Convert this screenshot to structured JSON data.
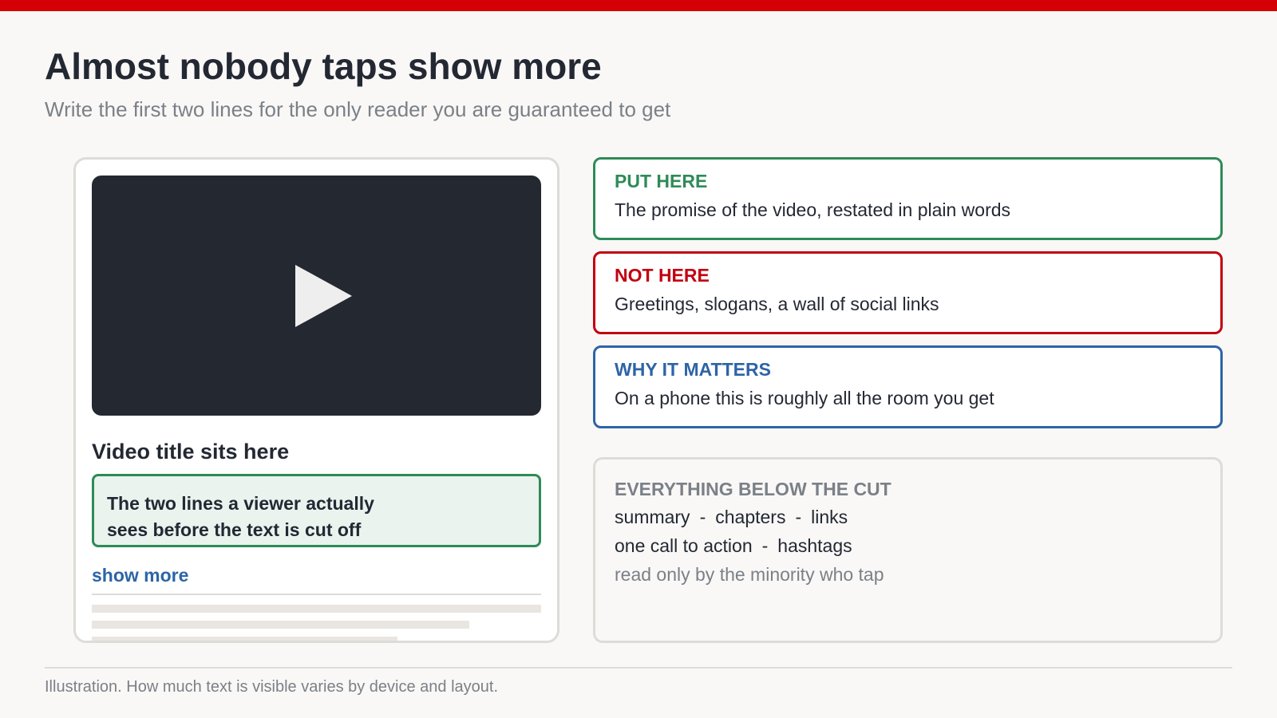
{
  "header": {
    "title": "Almost nobody taps show more",
    "subtitle": "Write the first two lines for the only reader you are guaranteed to get"
  },
  "phone": {
    "play_icon": "play-icon",
    "video_title": "Video title sits here",
    "preview_lines": [
      "The two lines a viewer actually",
      "sees before the text is cut off"
    ],
    "show_more": "show more"
  },
  "callouts": [
    {
      "label": "PUT HERE",
      "text": "The promise of the video, restated in plain words",
      "color": "#2e8b57"
    },
    {
      "label": "NOT HERE",
      "text": "Greetings, slogans, a wall of social links",
      "color": "#c20010"
    },
    {
      "label": "WHY IT MATTERS",
      "text": "On a phone this is roughly all the room you get",
      "color": "#2e64a6"
    }
  ],
  "below_cut": {
    "label": "EVERYTHING BELOW THE CUT",
    "line1": [
      "summary",
      "chapters",
      "links"
    ],
    "line2": [
      "one call to action",
      "hashtags"
    ],
    "separator": "-",
    "note": "read only by the minority who tap"
  },
  "footer": {
    "note": "Illustration. How much text is visible varies by device and layout."
  },
  "colors": {
    "accent_bar": "#d40006",
    "dark": "#232833",
    "muted": "#7b8088"
  }
}
